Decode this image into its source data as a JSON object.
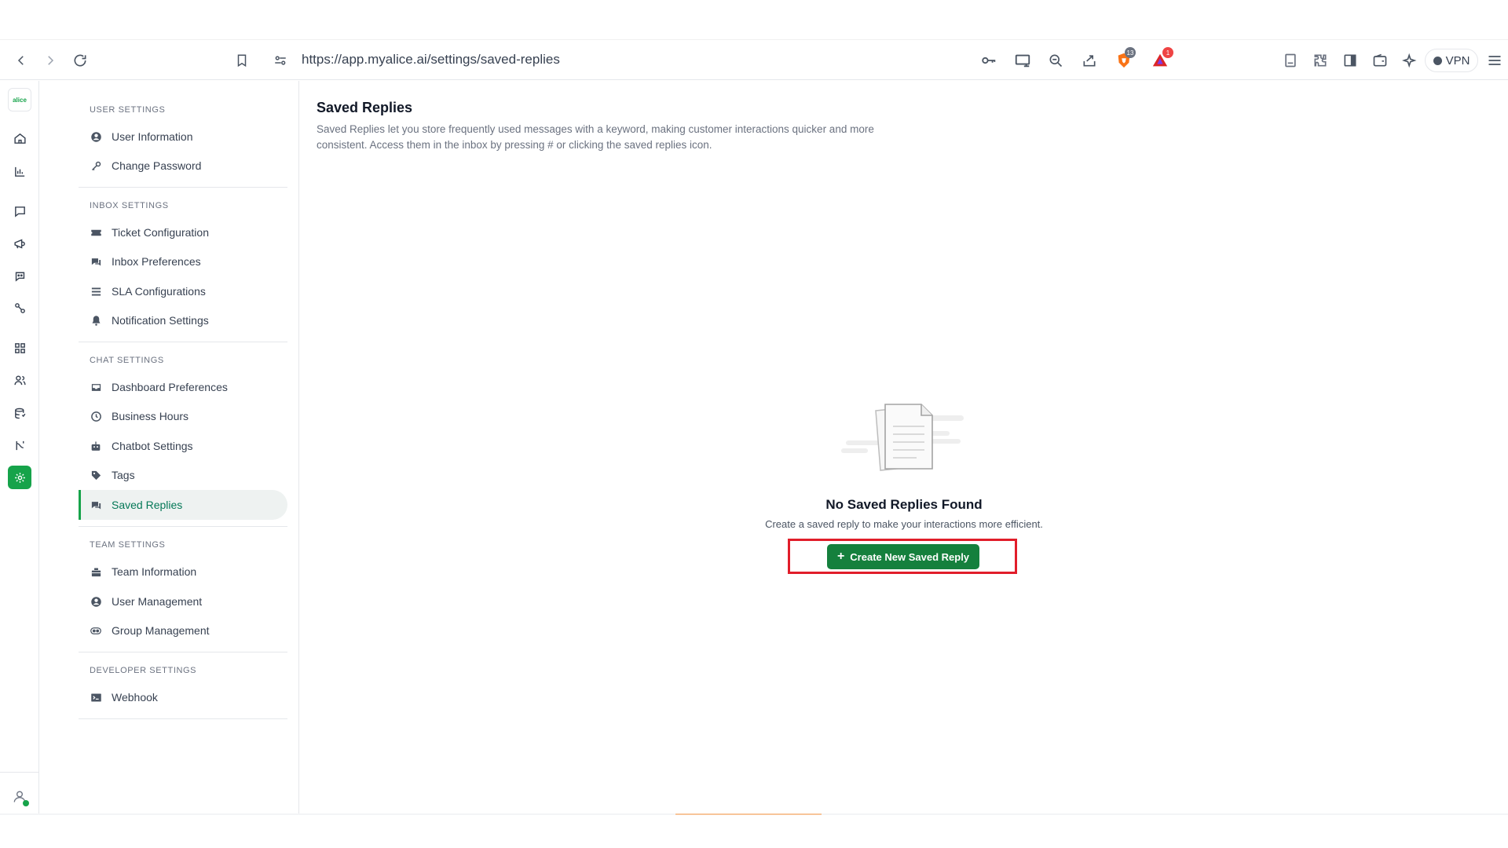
{
  "browser": {
    "url": "https://app.myalice.ai/settings/saved-replies",
    "vpn_label": "VPN",
    "brave_badge": "13",
    "alert_badge": "1"
  },
  "rail": {
    "logo_text": "alice"
  },
  "settings_nav": {
    "sections": [
      {
        "title": "USER SETTINGS",
        "items": [
          {
            "label": "User Information",
            "icon": "user-circle-icon"
          },
          {
            "label": "Change Password",
            "icon": "key-icon"
          }
        ]
      },
      {
        "title": "INBOX SETTINGS",
        "items": [
          {
            "label": "Ticket Configuration",
            "icon": "ticket-icon"
          },
          {
            "label": "Inbox Preferences",
            "icon": "chat-bubble-icon"
          },
          {
            "label": "SLA Configurations",
            "icon": "list-icon"
          },
          {
            "label": "Notification Settings",
            "icon": "bell-icon"
          }
        ]
      },
      {
        "title": "CHAT SETTINGS",
        "items": [
          {
            "label": "Dashboard Preferences",
            "icon": "inbox-tray-icon"
          },
          {
            "label": "Business Hours",
            "icon": "clock-icon"
          },
          {
            "label": "Chatbot Settings",
            "icon": "robot-icon"
          },
          {
            "label": "Tags",
            "icon": "tag-icon"
          },
          {
            "label": "Saved Replies",
            "icon": "saved-replies-icon"
          }
        ]
      },
      {
        "title": "TEAM SETTINGS",
        "items": [
          {
            "label": "Team Information",
            "icon": "team-icon"
          },
          {
            "label": "User Management",
            "icon": "user-circle-icon"
          },
          {
            "label": "Group Management",
            "icon": "group-icon"
          }
        ]
      },
      {
        "title": "DEVELOPER SETTINGS",
        "items": [
          {
            "label": "Webhook",
            "icon": "terminal-icon"
          }
        ]
      }
    ]
  },
  "main": {
    "title": "Saved Replies",
    "description": "Saved Replies let you store frequently used messages with a keyword, making customer interactions quicker and more consistent. Access them in the inbox by pressing # or clicking the saved replies icon.",
    "empty_state": {
      "title": "No Saved Replies Found",
      "subtitle": "Create a saved reply to make your interactions more efficient.",
      "button_label": "Create New Saved Reply"
    }
  },
  "colors": {
    "accent": "#15803d",
    "active_nav_text": "#047857",
    "highlight": "#e11d2a"
  }
}
